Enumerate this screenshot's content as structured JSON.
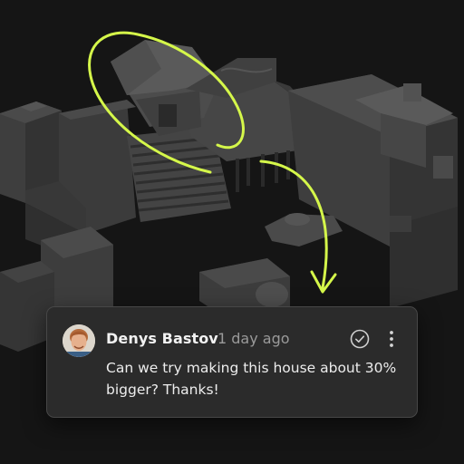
{
  "comment": {
    "author": "Denys Bastov",
    "time": "1 day ago",
    "text": "Can we try making this house about 30% bigger? Thanks!",
    "resolve_icon": "check-circle-icon",
    "menu_icon": "more-vertical-icon"
  },
  "annotation": {
    "color": "#d5f74a"
  }
}
